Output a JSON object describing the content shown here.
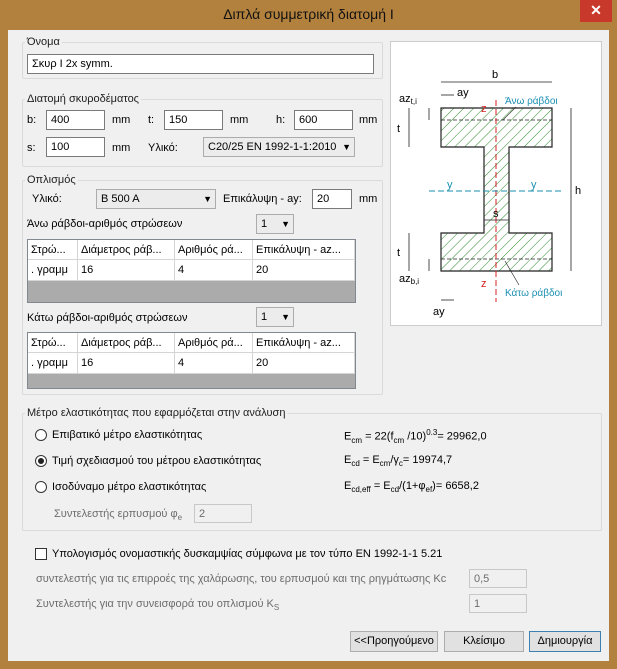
{
  "window": {
    "title": "Διπλά συμμετρική διατομή I",
    "close_glyph": "✕"
  },
  "name_group": {
    "title": "Όνομα",
    "value": "Σκυρ Ι 2x symm."
  },
  "concrete": {
    "title": "Διατομή σκυροδέματος",
    "b_label": "b:",
    "b_value": "400",
    "b_unit": "mm",
    "t_label": "t:",
    "t_value": "150",
    "t_unit": "mm",
    "h_label": "h:",
    "h_value": "600",
    "h_unit": "mm",
    "s_label": "s:",
    "s_value": "100",
    "s_unit": "mm",
    "material_label": "Υλικό:",
    "material_value": "C20/25  EN 1992-1-1:2010"
  },
  "reinforcement": {
    "title": "Οπλισμός",
    "material_label": "Υλικό:",
    "material_value": "B 500 A",
    "cover_label": "Επικάλυψη - ay:",
    "cover_value": "20",
    "cover_unit": "mm",
    "top_layers_label": "Άνω ράβδοι-αριθμός στρώσεων",
    "top_layers_value": "1",
    "bottom_layers_label": "Κάτω ράβδοι-αριθμός στρώσεων",
    "bottom_layers_value": "1",
    "columns": [
      "Στρώ...",
      "Διάμετρος ράβ...",
      "Αριθμός ρά...",
      "Επικάλυψη - az..."
    ],
    "top_rows": [
      [
        ". γραμμ",
        "16",
        "4",
        "20"
      ]
    ],
    "bottom_rows": [
      [
        ". γραμμ",
        "16",
        "4",
        "20"
      ]
    ]
  },
  "diagram": {
    "b": "b",
    "ay": "ay",
    "az_top": "az",
    "az_top_sub": "t,i",
    "t": "t",
    "z": "z",
    "top_bars": "Άνω ράβδοι",
    "y": "y",
    "h": "h",
    "s": "s",
    "az_bot": "az",
    "az_bot_sub": "b,i",
    "bottom_bars": "Κάτω ράβδοι",
    "colors": {
      "hatch": "#2e8b2e",
      "axis_red": "#d42020",
      "axis_blue": "#1a8fb0"
    }
  },
  "elasticity": {
    "title": "Μέτρο ελαστικότητας που εφαρμόζεται στην ανάλυση",
    "options": [
      {
        "label": "Επιβατικό μέτρο ελαστικότητας",
        "selected": false
      },
      {
        "label": "Τιμή σχεδιασμού του μέτρου ελαστικότητας",
        "selected": true
      },
      {
        "label": "Ισοδύναμο μέτρο ελαστικότητας",
        "selected": false
      }
    ],
    "f1": {
      "e": "E",
      "e_sub": "cm",
      "eq": " = 22(f",
      "f_sub": "cm",
      "tail": " /10)",
      "pow": "0.3",
      "res": "= 29962,0"
    },
    "f2": {
      "e": "E",
      "e_sub": "cd",
      "eq": " = E",
      "e2_sub": "cm",
      "mid": "/γ",
      "g_sub": "c",
      "res": "= 19974,7"
    },
    "f3": {
      "e": "E",
      "e_sub": "cd,eff",
      "eq": " = E",
      "e2_sub": "cd",
      "mid": "/(1+φ",
      "p_sub": "ef",
      "res": ")= 6658,2"
    },
    "creep_label": "Συντελεστής ερπυσμού",
    "creep_symbol": "φ",
    "creep_sub": "e",
    "creep_value": "2"
  },
  "stiffness": {
    "checkbox_label": "Υπολογισμός ονομαστικής δυσκαμψίας σύμφωνα με τον τύπο EN 1992-1-1 5.21",
    "kc_label": "συντελεστής για τις επιρροές της χαλάρωσης, του ερπυσμού και της ρηγμάτωσης Kc",
    "kc_value": "0,5",
    "ks_label": "Συντελεστής για την συνεισφορά του οπλισμού K",
    "ks_sub": "S",
    "ks_value": "1"
  },
  "buttons": {
    "previous": "<<Προηγούμενο",
    "close": "Κλείσιμο",
    "create": "Δημιουργία"
  }
}
